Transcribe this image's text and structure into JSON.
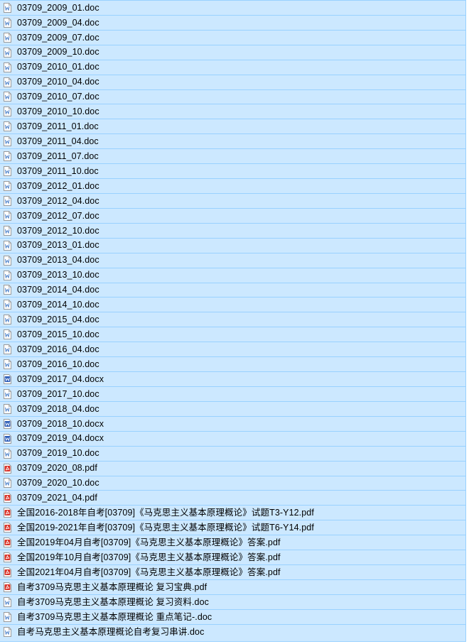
{
  "window": {
    "selection_bg": "#cce8ff",
    "selection_border": "#99d1ff"
  },
  "colors": {
    "doc_icon": "#4a7fc8",
    "docx_icon": "#2b5cb8",
    "pdf_icon": "#d9342b"
  },
  "files": [
    {
      "name": "03709_2009_01.doc",
      "icon": "doc-icon"
    },
    {
      "name": "03709_2009_04.doc",
      "icon": "doc-icon"
    },
    {
      "name": "03709_2009_07.doc",
      "icon": "doc-icon"
    },
    {
      "name": "03709_2009_10.doc",
      "icon": "doc-icon"
    },
    {
      "name": "03709_2010_01.doc",
      "icon": "doc-icon"
    },
    {
      "name": "03709_2010_04.doc",
      "icon": "doc-icon"
    },
    {
      "name": "03709_2010_07.doc",
      "icon": "doc-icon"
    },
    {
      "name": "03709_2010_10.doc",
      "icon": "doc-icon"
    },
    {
      "name": "03709_2011_01.doc",
      "icon": "doc-icon"
    },
    {
      "name": "03709_2011_04.doc",
      "icon": "doc-icon"
    },
    {
      "name": "03709_2011_07.doc",
      "icon": "doc-icon"
    },
    {
      "name": "03709_2011_10.doc",
      "icon": "doc-icon"
    },
    {
      "name": "03709_2012_01.doc",
      "icon": "doc-icon"
    },
    {
      "name": "03709_2012_04.doc",
      "icon": "doc-icon"
    },
    {
      "name": "03709_2012_07.doc",
      "icon": "doc-icon"
    },
    {
      "name": "03709_2012_10.doc",
      "icon": "doc-icon"
    },
    {
      "name": "03709_2013_01.doc",
      "icon": "doc-icon"
    },
    {
      "name": "03709_2013_04.doc",
      "icon": "doc-icon"
    },
    {
      "name": "03709_2013_10.doc",
      "icon": "doc-icon"
    },
    {
      "name": "03709_2014_04.doc",
      "icon": "doc-icon"
    },
    {
      "name": "03709_2014_10.doc",
      "icon": "doc-icon"
    },
    {
      "name": "03709_2015_04.doc",
      "icon": "doc-icon"
    },
    {
      "name": "03709_2015_10.doc",
      "icon": "doc-icon"
    },
    {
      "name": "03709_2016_04.doc",
      "icon": "doc-icon"
    },
    {
      "name": "03709_2016_10.doc",
      "icon": "doc-icon"
    },
    {
      "name": "03709_2017_04.docx",
      "icon": "docx-icon"
    },
    {
      "name": "03709_2017_10.doc",
      "icon": "doc-icon"
    },
    {
      "name": "03709_2018_04.doc",
      "icon": "doc-icon"
    },
    {
      "name": "03709_2018_10.docx",
      "icon": "docx-icon"
    },
    {
      "name": "03709_2019_04.docx",
      "icon": "docx-icon"
    },
    {
      "name": "03709_2019_10.doc",
      "icon": "doc-icon"
    },
    {
      "name": "03709_2020_08.pdf",
      "icon": "pdf-icon"
    },
    {
      "name": "03709_2020_10.doc",
      "icon": "doc-icon"
    },
    {
      "name": "03709_2021_04.pdf",
      "icon": "pdf-icon"
    },
    {
      "name": "全国2016-2018年自考[03709]《马克思主义基本原理概论》试题T3-Y12.pdf",
      "icon": "pdf-icon"
    },
    {
      "name": "全国2019-2021年自考[03709]《马克思主义基本原理概论》试题T6-Y14.pdf",
      "icon": "pdf-icon"
    },
    {
      "name": "全国2019年04月自考[03709]《马克思主义基本原理概论》答案.pdf",
      "icon": "pdf-icon"
    },
    {
      "name": "全国2019年10月自考[03709]《马克思主义基本原理概论》答案.pdf",
      "icon": "pdf-icon"
    },
    {
      "name": "全国2021年04月自考[03709]《马克思主义基本原理概论》答案.pdf",
      "icon": "pdf-icon"
    },
    {
      "name": "自考3709马克思主义基本原理概论 复习宝典.pdf",
      "icon": "pdf-icon"
    },
    {
      "name": "自考3709马克思主义基本原理概论 复习资料.doc",
      "icon": "doc-icon"
    },
    {
      "name": "自考3709马克思主义基本原理概论 重点笔记-.doc",
      "icon": "doc-icon"
    },
    {
      "name": "自考马克思主义基本原理概论自考复习串讲.doc",
      "icon": "doc-icon"
    }
  ]
}
